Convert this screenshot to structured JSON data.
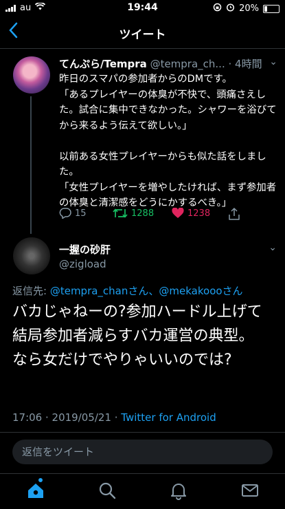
{
  "status_bar": {
    "carrier": "au",
    "time": "19:44",
    "battery": "20%"
  },
  "nav": {
    "title": "ツイート"
  },
  "tweet1": {
    "name": "てんぷら/Tempra",
    "handle": "@tempra_ch...",
    "time": "· 4時間",
    "body": "昨日のスマパの参加者からのDMです。\n「あるプレイヤーの体臭が不快で、頭痛さえした。試合に集中できなかった。シャワーを浴びてから来るよう伝えて欲しい。」\n\n以前ある女性プレイヤーからも似た話をしました。\n「女性プレイヤーを増やしたければ、まず参加者の体臭と清潔感をどうにかするべき。」",
    "replies": "15",
    "retweets": "1288",
    "likes": "1238"
  },
  "tweet2": {
    "name": "一握の砂肝",
    "handle": "@zigload",
    "reply_prefix": "返信先: ",
    "reply_user1": "@tempra_chan",
    "reply_san1": "さん、",
    "reply_user2": "@mekakooo",
    "reply_san2": "さん",
    "body": "バカじゃねーの?参加ハードル上げて結局参加者減らすバカ運営の典型。\nなら女だけでやりゃいいのでは?",
    "timestamp": "17:06 · 2019/05/21 · ",
    "client": "Twitter for Android"
  },
  "reply_bar": {
    "placeholder": "返信をツイート"
  },
  "colors": {
    "accent": "#1da1f2",
    "retweet": "#17bf63",
    "like": "#e0245e",
    "muted": "#8899a6"
  },
  "tabs": [
    "home-icon",
    "search-icon",
    "notifications-icon",
    "messages-icon"
  ]
}
